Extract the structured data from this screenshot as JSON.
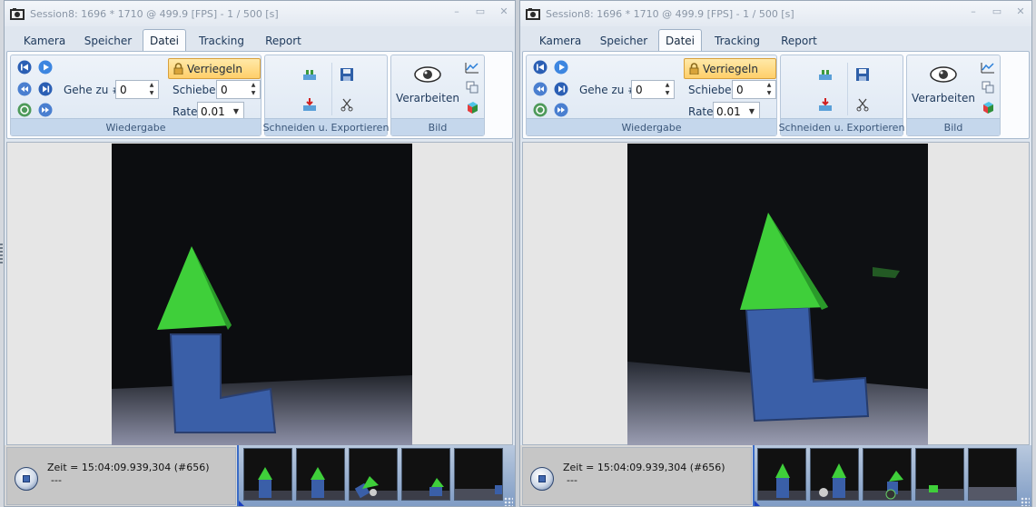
{
  "windows": [
    {
      "title": "Session8: 1696 * 1710 @ 499.9 [FPS] - 1 / 500 [s]",
      "tabs": [
        "Kamera",
        "Speicher",
        "Datei",
        "Tracking",
        "Report"
      ],
      "active_tab": "Datei",
      "wiedergabe": {
        "goto_label": "Gehe zu #",
        "goto_value": "0",
        "lock_label": "Verriegeln",
        "shift_label": "Schiebe",
        "shift_value": "0",
        "rate_label": "Rate",
        "rate_value": "0.01",
        "group_label": "Wiedergabe"
      },
      "schneiden": {
        "group_label": "Schneiden u. Exportieren"
      },
      "bild": {
        "process_label": "Verarbeiten",
        "group_label": "Bild"
      },
      "status": {
        "time_text": "Zeit = 15:04:09.939,304 (#656)",
        "sub_text": "---"
      }
    },
    {
      "title": "Session8: 1696 * 1710 @ 499.9 [FPS] - 1 / 500 [s]",
      "tabs": [
        "Kamera",
        "Speicher",
        "Datei",
        "Tracking",
        "Report"
      ],
      "active_tab": "Datei",
      "wiedergabe": {
        "goto_label": "Gehe zu #",
        "goto_value": "0",
        "lock_label": "Verriegeln",
        "shift_label": "Schiebe",
        "shift_value": "0",
        "rate_label": "Rate",
        "rate_value": "0.01",
        "group_label": "Wiedergabe"
      },
      "schneiden": {
        "group_label": "Schneiden u. Exportieren"
      },
      "bild": {
        "process_label": "Verarbeiten",
        "group_label": "Bild"
      },
      "status": {
        "time_text": "Zeit = 15:04:09.939,304 (#656)",
        "sub_text": "---"
      }
    }
  ],
  "colors": {
    "accent": "#3a6bc6",
    "lock_button": "#ffcf6a",
    "block_blue": "#3a5fa8",
    "roof_green": "#3fcf3a"
  }
}
